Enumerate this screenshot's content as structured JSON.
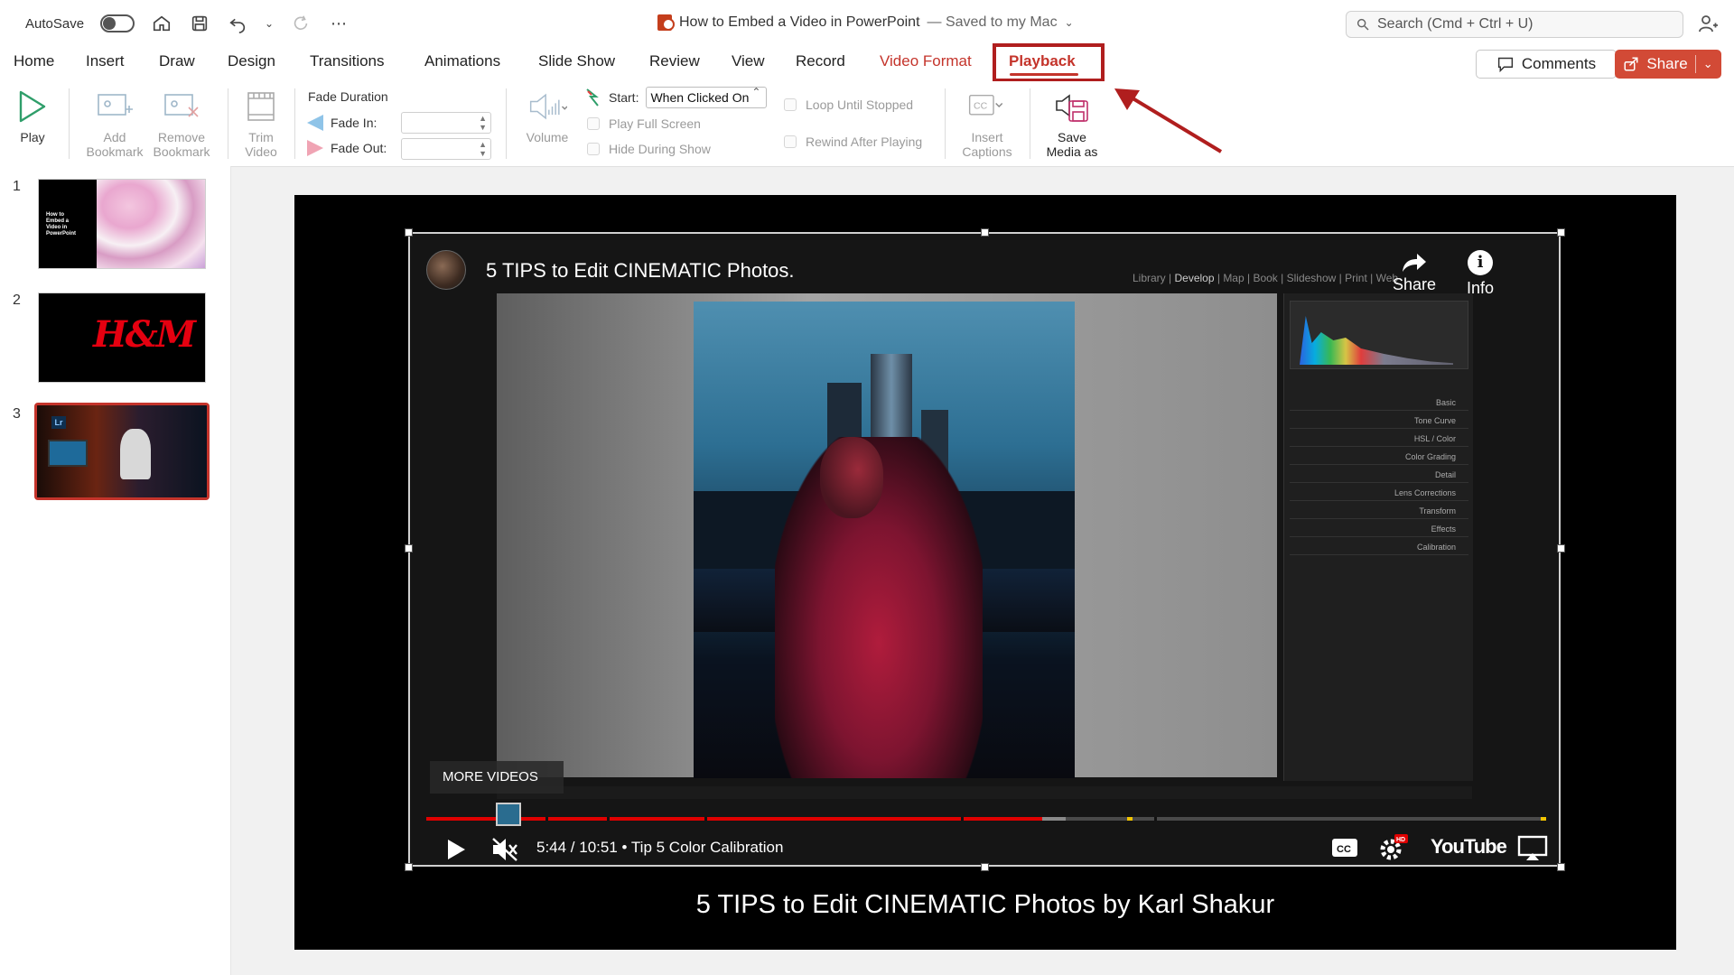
{
  "titlebar": {
    "autosave_label": "AutoSave",
    "doc_title": "How to Embed a Video in PowerPoint",
    "doc_saved": "— Saved to my Mac",
    "search_placeholder": "Search (Cmd + Ctrl + U)"
  },
  "tabs": [
    {
      "label": "Home"
    },
    {
      "label": "Insert"
    },
    {
      "label": "Draw"
    },
    {
      "label": "Design"
    },
    {
      "label": "Transitions"
    },
    {
      "label": "Animations"
    },
    {
      "label": "Slide Show"
    },
    {
      "label": "Review"
    },
    {
      "label": "View"
    },
    {
      "label": "Record"
    },
    {
      "label": "Video Format"
    },
    {
      "label": "Playback"
    }
  ],
  "actions": {
    "comments_label": "Comments",
    "share_label": "Share"
  },
  "ribbon": {
    "play": "Play",
    "add_bookmark_1": "Add",
    "add_bookmark_2": "Bookmark",
    "remove_bookmark_1": "Remove",
    "remove_bookmark_2": "Bookmark",
    "trim_1": "Trim",
    "trim_2": "Video",
    "fade_duration": "Fade Duration",
    "fade_in": "Fade In:",
    "fade_out": "Fade Out:",
    "volume": "Volume",
    "start_label": "Start:",
    "start_value": "When Clicked On",
    "play_full_screen": "Play Full Screen",
    "hide_during_show": "Hide During Show",
    "loop_until_stopped": "Loop Until Stopped",
    "rewind_after_playing": "Rewind After Playing",
    "insert_captions_1": "Insert",
    "insert_captions_2": "Captions",
    "save_media_1": "Save",
    "save_media_2": "Media as"
  },
  "slides": [
    {
      "number": "1",
      "text": "How to Embed a Video in PowerPoint"
    },
    {
      "number": "2",
      "logo": "H&M"
    },
    {
      "number": "3",
      "badge": "Lr"
    }
  ],
  "video": {
    "title": "5 TIPS to Edit CINEMATIC Photos.",
    "share": "Share",
    "info": "Info",
    "more_videos": "MORE VIDEOS",
    "time": "5:44 / 10:51",
    "chapter": "•  Tip 5 Color Calibration",
    "progress": 0.55,
    "brand": "YouTube",
    "lr_nav": [
      "Library",
      "Develop",
      "Map",
      "Book",
      "Slideshow",
      "Print",
      "Web"
    ],
    "lr_panels": [
      "Basic",
      "Tone Curve",
      "HSL / Color",
      "Color Grading",
      "Detail",
      "Lens Corrections",
      "Transform",
      "Effects",
      "Calibration"
    ]
  },
  "caption": "5 TIPS to Edit CINEMATIC Photos by Karl Shakur",
  "colors": {
    "accent": "#c4342b",
    "share_bg": "#d24a36",
    "annotation": "#b01e1e",
    "yt_red": "#e00000"
  }
}
